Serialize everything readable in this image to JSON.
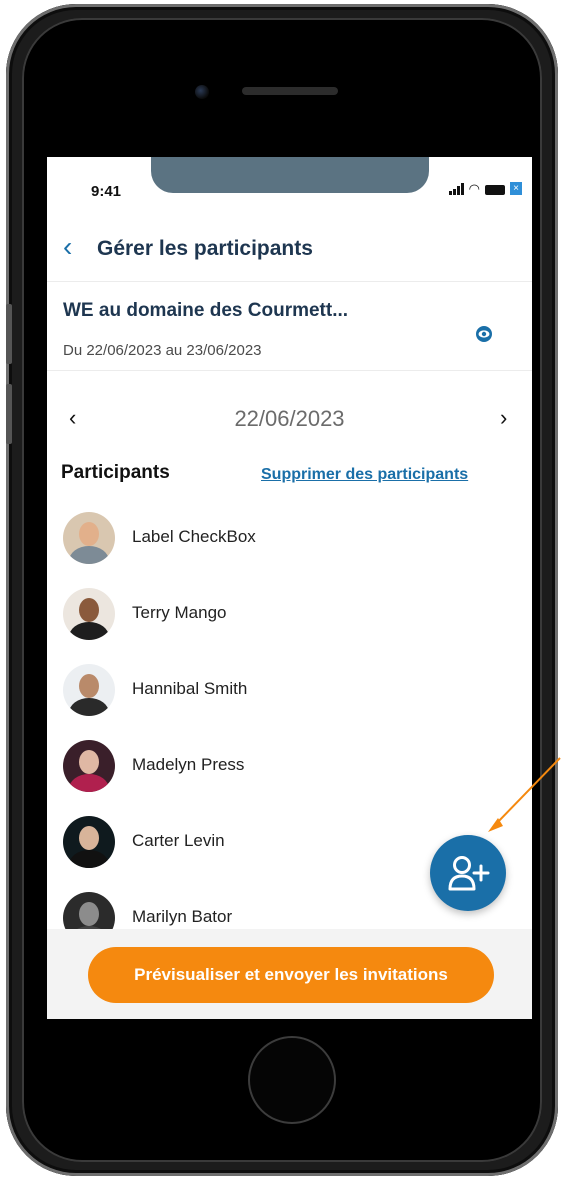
{
  "status_bar": {
    "time": "9:41",
    "close_glyph": "×"
  },
  "header": {
    "back_icon": "chevron-left-icon",
    "title": "Gérer les participants"
  },
  "event": {
    "title": "WE au domaine des Courmett...",
    "dates": "Du 22/06/2023 au 23/06/2023",
    "preview_icon": "eye-icon"
  },
  "date_nav": {
    "prev": "‹",
    "date": "22/06/2023",
    "next": "›"
  },
  "participants": {
    "heading": "Participants",
    "remove_link": "Supprimer des participants",
    "items": [
      {
        "name": "Label CheckBox"
      },
      {
        "name": "Terry Mango"
      },
      {
        "name": "Hannibal Smith"
      },
      {
        "name": "Madelyn Press"
      },
      {
        "name": "Carter Levin"
      },
      {
        "name": "Marilyn Bator"
      }
    ]
  },
  "fab": {
    "icon": "add-user-icon"
  },
  "footer": {
    "cta_label": "Prévisualiser et envoyer les invitations"
  },
  "colors": {
    "primary": "#1a6fa8",
    "accent": "#f5890f",
    "title": "#1e3650"
  }
}
